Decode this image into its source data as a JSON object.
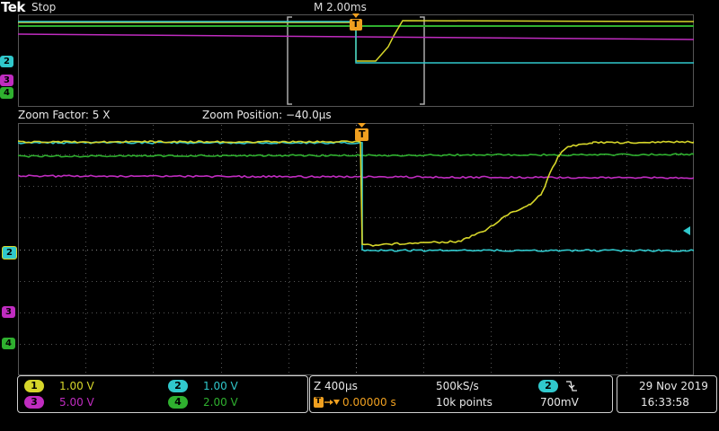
{
  "header": {
    "brand": "Tek",
    "state": "Stop",
    "timebase": "M 2.00ms"
  },
  "zoom": {
    "factor": "Zoom Factor: 5 X",
    "position": "Zoom Position: −40.0µs"
  },
  "colors": {
    "ch1": "#d6d62a",
    "ch2": "#30c8cc",
    "ch3": "#c02cc0",
    "ch4": "#2fb02f",
    "trigger": "#f0a020"
  },
  "markers": {
    "trigger": "T",
    "ch1": "1",
    "ch2": "2",
    "ch3": "3",
    "ch4": "4"
  },
  "channels": [
    {
      "id": "1",
      "scale": "1.00 V"
    },
    {
      "id": "2",
      "scale": "1.00 V"
    },
    {
      "id": "3",
      "scale": "5.00 V"
    },
    {
      "id": "4",
      "scale": "2.00 V"
    }
  ],
  "horizontal": {
    "zoom_scale": "Z 400µs",
    "sample_rate": "500kS/s",
    "trigger_pos": "0.00000 s",
    "record": "10k points"
  },
  "trigger": {
    "source": "2",
    "slope_icon": "falling-edge-icon",
    "level": "700mV"
  },
  "datetime": {
    "date": "29 Nov 2019",
    "time": "16:33:58"
  }
}
